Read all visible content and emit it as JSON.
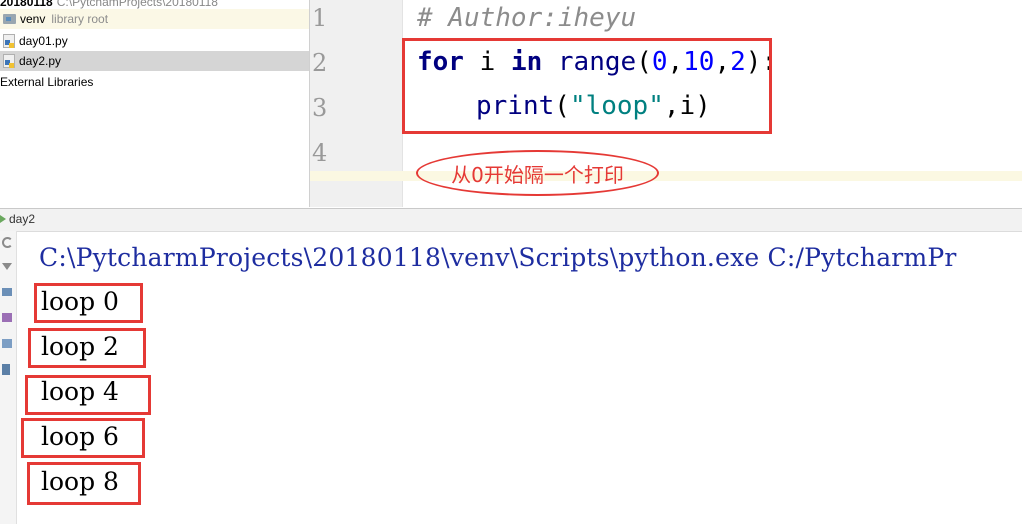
{
  "project_tree": {
    "root_label": "20180118",
    "root_path": "C:\\PytchamProjects\\20180118",
    "items": [
      {
        "label": "venv",
        "note": "library root"
      },
      {
        "label": "day01.py"
      },
      {
        "label": "day2.py"
      },
      {
        "label": "External Libraries"
      }
    ]
  },
  "editor": {
    "line_numbers": [
      "1",
      "2",
      "3",
      "4"
    ],
    "line1_comment": "# Author:iheyu",
    "line2": {
      "kw_for": "for",
      "var": "i",
      "kw_in": "in",
      "fn": "range",
      "open": "(",
      "a": "0",
      "sep1": ",",
      "b": "10",
      "sep2": ",",
      "c": "2",
      "close": "):"
    },
    "line3": {
      "fn": "print",
      "open": "(",
      "str": "\"loop\"",
      "rest": ",i)"
    },
    "annotation": "从0开始隔一个打印"
  },
  "run": {
    "tab_label": "day2",
    "command": "C:\\PytcharmProjects\\20180118\\venv\\Scripts\\python.exe C:/PytcharmPr",
    "output": [
      "loop 0",
      "loop 2",
      "loop 4",
      "loop 6",
      "loop 8"
    ]
  },
  "colors": {
    "highlight_red": "#e53935",
    "keyword": "#000080",
    "number": "#0000ff",
    "string": "#008080",
    "console_path": "#1e2da0"
  }
}
